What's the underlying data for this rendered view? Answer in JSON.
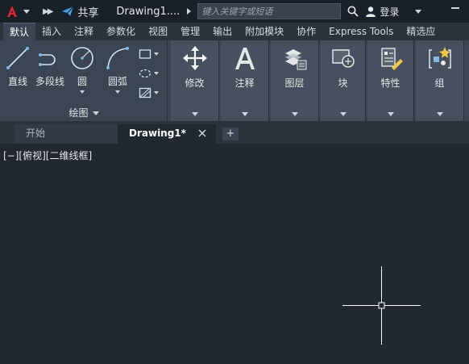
{
  "titlebar": {
    "share_label": "共享",
    "doc_title": "Drawing1....",
    "search_placeholder": "键入关键字或短语",
    "login_label": "登录"
  },
  "ribbon_tabs": [
    "默认",
    "插入",
    "注释",
    "参数化",
    "视图",
    "管理",
    "输出",
    "附加模块",
    "协作",
    "Express Tools",
    "精选应"
  ],
  "draw_panel": {
    "tools": [
      "直线",
      "多段线",
      "圆",
      "圆弧"
    ],
    "title": "绘图"
  },
  "panels": [
    "修改",
    "注释",
    "图层",
    "块",
    "特性",
    "组"
  ],
  "doc_tabs": {
    "start": "开始",
    "drawing": "Drawing1*",
    "add": "+"
  },
  "viewport_label": "[−][俯视][二维线框]",
  "colors": {
    "accent_red": "#e0252c",
    "share_blue": "#4aa3e6",
    "canvas_bg": "#212830"
  }
}
